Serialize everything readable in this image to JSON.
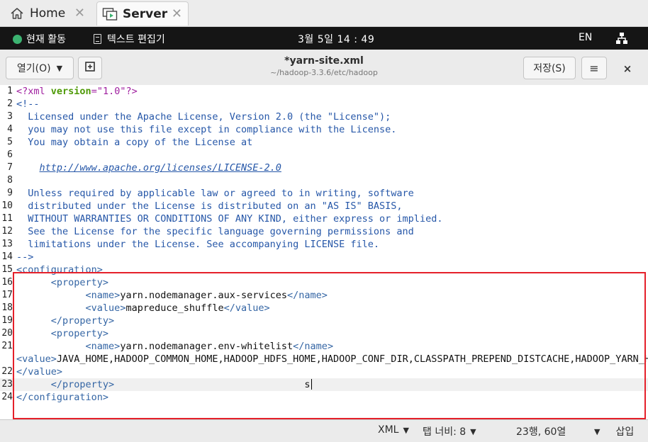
{
  "viewer_tabs": {
    "home": {
      "label": "Home",
      "icon": "home-icon"
    },
    "server": {
      "label": "Server",
      "icon": "vm-console-icon"
    }
  },
  "topbar": {
    "activities": "현재 활동",
    "app_name": "텍스트 편집기",
    "clock": "3월 5일 14 : 49",
    "language": "EN",
    "network_icon": "network-wired-icon"
  },
  "header": {
    "open_label": "열기(O)",
    "title": "*yarn-site.xml",
    "subtitle": "~/hadoop-3.3.6/etc/hadoop",
    "save_label": "저장(S)",
    "menu_icon": "≡",
    "close_icon": "×"
  },
  "editor": {
    "current_line": 23,
    "lines": [
      {
        "n": "1",
        "segs": [
          [
            "pi",
            "<?xml "
          ],
          [
            "attr",
            "version"
          ],
          [
            "pi",
            "="
          ],
          [
            "str",
            "\"1.0\""
          ],
          [
            "pi",
            "?>"
          ]
        ]
      },
      {
        "n": "2",
        "segs": [
          [
            "comment",
            "<!--"
          ]
        ]
      },
      {
        "n": "3",
        "segs": [
          [
            "comment",
            "  Licensed under the Apache License, Version 2.0 (the \"License\");"
          ]
        ]
      },
      {
        "n": "4",
        "segs": [
          [
            "comment",
            "  you may not use this file except in compliance with the License."
          ]
        ]
      },
      {
        "n": "5",
        "segs": [
          [
            "comment",
            "  You may obtain a copy of the License at"
          ]
        ]
      },
      {
        "n": "6",
        "segs": []
      },
      {
        "n": "7",
        "segs": [
          [
            "comment",
            "    "
          ],
          [
            "link",
            "http://www.apache.org/licenses/LICENSE-2.0"
          ]
        ]
      },
      {
        "n": "8",
        "segs": []
      },
      {
        "n": "9",
        "segs": [
          [
            "comment",
            "  Unless required by applicable law or agreed to in writing, software"
          ]
        ]
      },
      {
        "n": "10",
        "segs": [
          [
            "comment",
            "  distributed under the License is distributed on an \"AS IS\" BASIS,"
          ]
        ]
      },
      {
        "n": "11",
        "segs": [
          [
            "comment",
            "  WITHOUT WARRANTIES OR CONDITIONS OF ANY KIND, either express or implied."
          ]
        ]
      },
      {
        "n": "12",
        "segs": [
          [
            "comment",
            "  See the License for the specific language governing permissions and"
          ]
        ]
      },
      {
        "n": "13",
        "segs": [
          [
            "comment",
            "  limitations under the License. See accompanying LICENSE file."
          ]
        ]
      },
      {
        "n": "14",
        "segs": [
          [
            "comment",
            "-->"
          ]
        ]
      },
      {
        "n": "15",
        "segs": [
          [
            "tag",
            "<configuration>"
          ]
        ]
      },
      {
        "n": "16",
        "segs": [
          [
            "text",
            "      "
          ],
          [
            "tag",
            "<property>"
          ]
        ]
      },
      {
        "n": "17",
        "segs": [
          [
            "text",
            "            "
          ],
          [
            "tag",
            "<name>"
          ],
          [
            "text",
            "yarn.nodemanager.aux-services"
          ],
          [
            "tag",
            "</name>"
          ]
        ]
      },
      {
        "n": "18",
        "segs": [
          [
            "text",
            "            "
          ],
          [
            "tag",
            "<value>"
          ],
          [
            "text",
            "mapreduce_shuffle"
          ],
          [
            "tag",
            "</value>"
          ]
        ]
      },
      {
        "n": "19",
        "segs": [
          [
            "text",
            "      "
          ],
          [
            "tag",
            "</property>"
          ]
        ]
      },
      {
        "n": "20",
        "segs": [
          [
            "text",
            "      "
          ],
          [
            "tag",
            "<property>"
          ]
        ]
      },
      {
        "n": "21",
        "segs": [
          [
            "text",
            "            "
          ],
          [
            "tag",
            "<name>"
          ],
          [
            "text",
            "yarn.nodemanager.env-whitelist"
          ],
          [
            "tag",
            "</name>"
          ]
        ]
      },
      {
        "n": "",
        "segs": [
          [
            "tag",
            "<value>"
          ],
          [
            "text",
            "JAVA_HOME,HADOOP_COMMON_HOME,HADOOP_HDFS_HOME,HADOOP_CONF_DIR,CLASSPATH_PREPEND_DISTCACHE,HADOOP_YARN_HOME,HADOOP_HOME,PATH,LANG,TZ,HADOOP_MAPRED_HOME"
          ]
        ]
      },
      {
        "n": "22",
        "segs": [
          [
            "tag",
            "</value>"
          ]
        ]
      },
      {
        "n": "23",
        "segs": [
          [
            "text",
            "      "
          ],
          [
            "tag",
            "</property>"
          ],
          [
            "text",
            "                                 s"
          ]
        ]
      },
      {
        "n": "24",
        "segs": [
          [
            "tag",
            "</configuration>"
          ]
        ]
      }
    ]
  },
  "statusbar": {
    "language": "XML",
    "tab_width": "탭 너비: 8",
    "position": "23행, 60열",
    "mode": "삽입"
  }
}
